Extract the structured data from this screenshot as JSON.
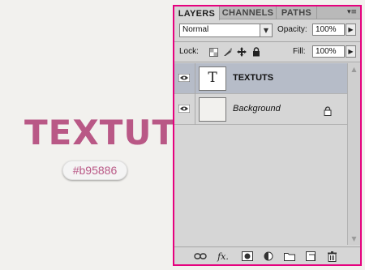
{
  "canvas": {
    "title": "TEXTUTS",
    "color_badge": "#b95886",
    "title_color": "#b95886",
    "highlight_color": "#e6007e"
  },
  "panel": {
    "tabs": [
      "LAYERS",
      "CHANNELS",
      "PATHS"
    ],
    "active_tab": "LAYERS",
    "blend_mode": "Normal",
    "opacity_label": "Opacity:",
    "opacity_value": "100%",
    "lock_label": "Lock:",
    "fill_label": "Fill:",
    "fill_value": "100%",
    "layers": [
      {
        "name": "TEXTUTS",
        "type": "text",
        "thumb_glyph": "T",
        "selected": true,
        "visible": true,
        "locked": false
      },
      {
        "name": "Background",
        "type": "background",
        "selected": false,
        "visible": true,
        "locked": true
      }
    ],
    "bottom_icons": [
      "link-layers-icon",
      "fx-icon",
      "add-mask-icon",
      "adjustment-layer-icon",
      "new-group-icon",
      "new-layer-icon",
      "trash-icon"
    ],
    "fx_label": "fx."
  }
}
